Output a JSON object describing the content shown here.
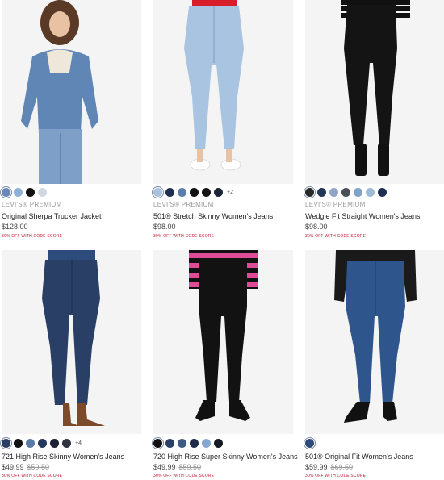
{
  "products": [
    {
      "id": "p1",
      "brand": "LEVI'S® PREMIUM",
      "name": "Original Sherpa Trucker Jacket",
      "price": "$128.00",
      "old_price": "",
      "promo": "30% OFF WITH CODE SCORE",
      "swatches": [
        "#6b87b8",
        "#8fb0d6",
        "#111111",
        "#cfd8e2"
      ],
      "more": ""
    },
    {
      "id": "p2",
      "brand": "LEVI'S® PREMIUM",
      "name": "501® Stretch Skinny Women's Jeans",
      "price": "$98.00",
      "old_price": "",
      "promo": "30% OFF WITH CODE SCORE",
      "swatches": [
        "#a9c3dd",
        "#1f2d4e",
        "#5b7fa8",
        "#111111",
        "#141414",
        "#1c2538"
      ],
      "more": "+2"
    },
    {
      "id": "p3",
      "brand": "LEVI'S® PREMIUM",
      "name": "Wedgie Fit Straight Women's Jeans",
      "price": "$98.00",
      "old_price": "",
      "promo": "30% OFF WITH CODE SCORE",
      "swatches": [
        "#2a2a2a",
        "#243558",
        "#8fa7c4",
        "#4a4f57",
        "#7fa2c6",
        "#9dbad6",
        "#1e2e52"
      ],
      "more": ""
    },
    {
      "id": "p4",
      "brand": "",
      "name": "721 High Rise Skinny Women's Jeans",
      "price": "$49.99",
      "old_price": "$59.50",
      "promo": "30% OFF WITH CODE SCORE",
      "swatches": [
        "#2a3d62",
        "#111111",
        "#5a79a3",
        "#24385d",
        "#1b2233",
        "#2f3440"
      ],
      "more": "+4"
    },
    {
      "id": "p5",
      "brand": "",
      "name": "720 High Rise Super Skinny Women's Jeans",
      "price": "$49.99",
      "old_price": "$59.50",
      "promo": "30% OFF WITH CODE SCORE",
      "swatches": [
        "#111111",
        "#2a3f66",
        "#3d5a86",
        "#1d2b48",
        "#86a8d0",
        "#151a25"
      ],
      "more": ""
    },
    {
      "id": "p6",
      "brand": "",
      "name": "501® Original Fit Women's Jeans",
      "price": "$59.99",
      "old_price": "$69.50",
      "promo": "30% OFF WITH CODE SCORE",
      "swatches": [
        "#2d4a7a"
      ],
      "more": ""
    }
  ]
}
